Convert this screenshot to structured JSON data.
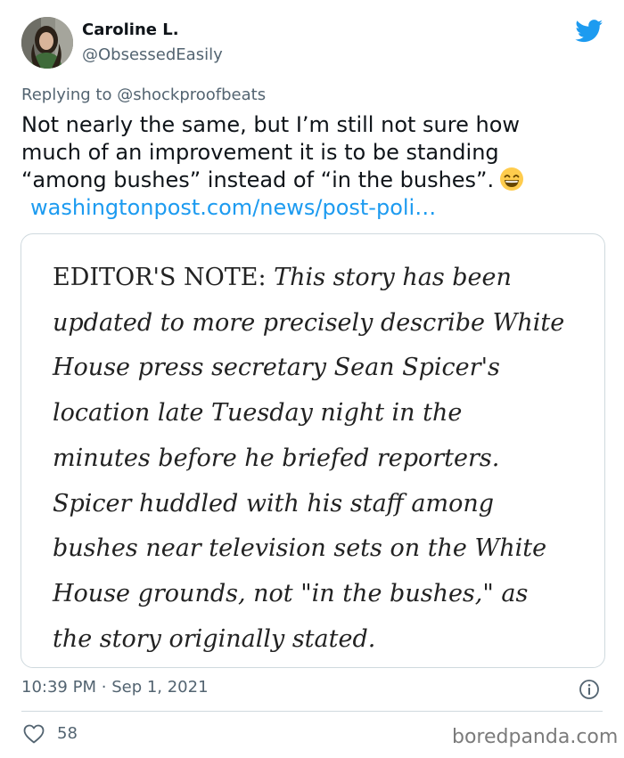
{
  "author": {
    "display_name": "Caroline L.",
    "handle": "@ObsessedEasily",
    "avatar_icon": "profile-photo"
  },
  "platform_icon": "twitter-bird-icon",
  "reply": {
    "prefix": "Replying to",
    "mention": "@shockproofbeats"
  },
  "tweet": {
    "lines": [
      "Not nearly the same, but I’m still not sure how",
      "much of an improvement it is to be standing",
      "“among bushes” instead of “in the bushes”."
    ],
    "emoji": "grinning-face-with-smiling-eyes",
    "link": "washingtonpost.com/news/post-poli…"
  },
  "media": {
    "lead": "EDITOR'S NOTE:",
    "lines": [
      " This story has been",
      "updated to more precisely describe White",
      "House press secretary Sean Spicer's",
      "location late Tuesday night in the",
      "minutes before he briefed reporters.",
      "Spicer huddled with his staff among",
      "bushes near television sets on the White",
      "House grounds, not \"in the bushes,\" as",
      "the story originally stated."
    ]
  },
  "meta": {
    "time": "10:39 PM",
    "separator": "·",
    "date": "Sep 1, 2021"
  },
  "stats": {
    "likes": "58"
  },
  "watermark": "boredpanda.com",
  "colors": {
    "accent": "#1d9bf0",
    "muted": "#536471",
    "border": "#cfd9de"
  }
}
